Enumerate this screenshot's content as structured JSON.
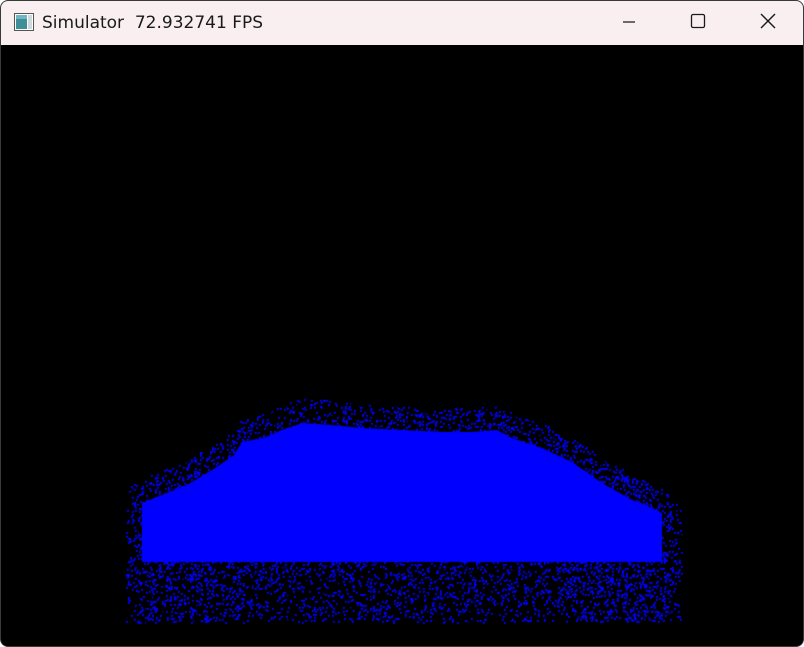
{
  "window": {
    "title": "Simulator  72.932741 FPS"
  },
  "icons": {
    "app": "window-app-icon",
    "minimize": "minimize-icon",
    "maximize": "maximize-icon",
    "close": "close-icon"
  },
  "colors": {
    "titlebar_bg": "#f9eff1",
    "canvas_bg": "#000000",
    "particles": "#0000ff"
  },
  "simulation": {
    "particle_color": "#0000ff"
  }
}
